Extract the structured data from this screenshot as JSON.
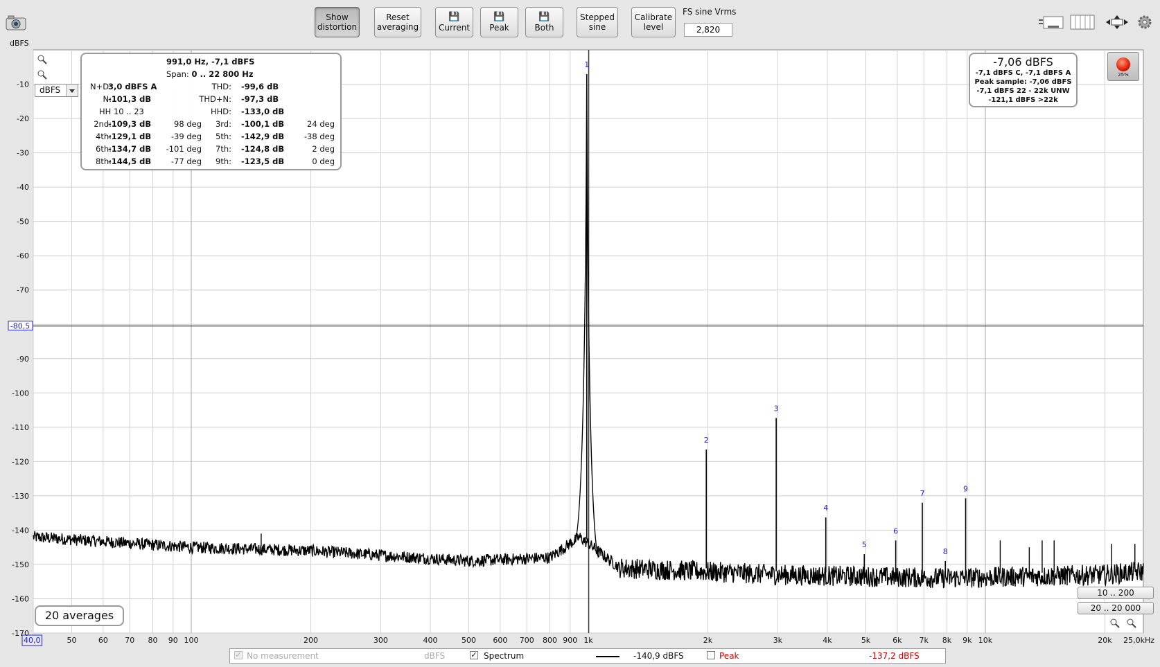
{
  "toolbar": {
    "show_distortion": "Show\ndistortion",
    "show_distortion_1": "Show",
    "show_distortion_2": "distortion",
    "reset_1": "Reset",
    "reset_2": "averaging",
    "current": "Current",
    "peak": "Peak",
    "both": "Both",
    "stepped_1": "Stepped",
    "stepped_2": "sine",
    "calibrate_1": "Calibrate",
    "calibrate_2": "level",
    "fs_label": "FS sine Vrms",
    "fs_value": "2,820"
  },
  "icons": [
    "camera-icon",
    "save-icon",
    "layout-icon",
    "grid-icon",
    "fit-arrows-icon",
    "gear-icon",
    "zoom-in-icon",
    "zoom-out-icon"
  ],
  "unit_label": "dBFS",
  "unit_select": "dBFS",
  "cursor_label": "-80,5",
  "cursor_value": -80.5,
  "info": {
    "title": "991,0 Hz, -7,1 dBFS",
    "span_label": "Span:",
    "span_value": "0 .. 22 800 Hz",
    "nd_label": "N+D:",
    "nd_value": "3,0 dBFS A",
    "n_label": "N:",
    "n_value": "-101,3 dB",
    "hh_label": "HH 10 .. 23",
    "thd_label": "THD:",
    "thd_value": "-99,6 dB",
    "thdn_label": "THD+N:",
    "thdn_value": "-97,3 dB",
    "hhd_label": "HHD:",
    "hhd_value": "-133,0 dB",
    "harmonics": [
      {
        "l": "2nd:",
        "v": "-109,3 dB",
        "p": "98 deg"
      },
      {
        "l": "3rd:",
        "v": "-100,1 dB",
        "p": "24 deg"
      },
      {
        "l": "4th:",
        "v": "-129,1 dB",
        "p": "-39 deg"
      },
      {
        "l": "5th:",
        "v": "-142,9 dB",
        "p": "-38 deg"
      },
      {
        "l": "6th:",
        "v": "-134,7 dB",
        "p": "-101 deg"
      },
      {
        "l": "7th:",
        "v": "-124,8 dB",
        "p": "2 deg"
      },
      {
        "l": "8th:",
        "v": "-144,5 dB",
        "p": "-77 deg"
      },
      {
        "l": "9th:",
        "v": "-123,5 dB",
        "p": "0 deg"
      }
    ]
  },
  "level": {
    "main": "-7,06 dBFS",
    "line1": "-7,1 dBFS C, -7,1 dBFS A",
    "line2": "Peak sample: -7,06 dBFS",
    "line3": "-7,1 dBFS 22 - 22k UNW",
    "line4": "-121,1 dBFS >22k"
  },
  "record": {
    "percent": "25%",
    "color": "#e21b00"
  },
  "averages": "20 averages",
  "ranges": {
    "r1": "10 .. 200",
    "r2": "20 .. 20 000"
  },
  "legend": {
    "no_measurement": "No measurement",
    "no_measurement_unit": "dBFS",
    "spectrum": "Spectrum",
    "spectrum_value": "-140,9 dBFS",
    "peak": "Peak",
    "peak_value": "-137,2 dBFS",
    "peak_color": "#cc0000"
  },
  "chart_data": {
    "type": "line",
    "xscale": "log",
    "xlim": [
      40,
      25000
    ],
    "ylim": [
      -170,
      0
    ],
    "ylabel": "dBFS",
    "grid": true,
    "y_ticks": [
      -10,
      -20,
      -30,
      -40,
      -50,
      -60,
      -70,
      -80,
      -90,
      -100,
      -110,
      -120,
      -130,
      -140,
      -150,
      -160,
      -170
    ],
    "x_ticks": [
      {
        "v": 40,
        "l": "40,0"
      },
      {
        "v": 50,
        "l": "50"
      },
      {
        "v": 60,
        "l": "60"
      },
      {
        "v": 70,
        "l": "70"
      },
      {
        "v": 80,
        "l": "80"
      },
      {
        "v": 90,
        "l": "90"
      },
      {
        "v": 100,
        "l": "100"
      },
      {
        "v": 200,
        "l": "200"
      },
      {
        "v": 300,
        "l": "300"
      },
      {
        "v": 400,
        "l": "400"
      },
      {
        "v": 500,
        "l": "500"
      },
      {
        "v": 600,
        "l": "600"
      },
      {
        "v": 700,
        "l": "700"
      },
      {
        "v": 800,
        "l": "800"
      },
      {
        "v": 900,
        "l": "900"
      },
      {
        "v": 1000,
        "l": "1k"
      },
      {
        "v": 2000,
        "l": "2k"
      },
      {
        "v": 3000,
        "l": "3k"
      },
      {
        "v": 4000,
        "l": "4k"
      },
      {
        "v": 5000,
        "l": "5k"
      },
      {
        "v": 6000,
        "l": "6k"
      },
      {
        "v": 7000,
        "l": "7k"
      },
      {
        "v": 8000,
        "l": "8k"
      },
      {
        "v": 9000,
        "l": "9k"
      },
      {
        "v": 10000,
        "l": "10k"
      },
      {
        "v": 20000,
        "l": "20k"
      },
      {
        "v": 25000,
        "l": "25,0kHz"
      }
    ],
    "noise_floor": [
      [
        40,
        -142
      ],
      [
        100,
        -145
      ],
      [
        200,
        -146
      ],
      [
        500,
        -149
      ],
      [
        800,
        -148
      ],
      [
        950,
        -142
      ],
      [
        1200,
        -151
      ],
      [
        3000,
        -153
      ],
      [
        8000,
        -154
      ],
      [
        20000,
        -153
      ],
      [
        25000,
        -152
      ]
    ],
    "peaks": [
      {
        "label": "1",
        "f": 991,
        "db": -7.1
      },
      {
        "label": "2",
        "f": 1982,
        "db": -116.5
      },
      {
        "label": "3",
        "f": 2973,
        "db": -107.3
      },
      {
        "label": "4",
        "f": 3964,
        "db": -136.3
      },
      {
        "label": "5",
        "f": 4955,
        "db": -147.0
      },
      {
        "label": "6",
        "f": 5946,
        "db": -143.0
      },
      {
        "label": "7",
        "f": 6937,
        "db": -132.0
      },
      {
        "label": "8",
        "f": 7928,
        "db": -149.0
      },
      {
        "label": "9",
        "f": 8919,
        "db": -130.7
      }
    ],
    "extra_spurs": [
      [
        150,
        -141
      ],
      [
        10900,
        -143
      ],
      [
        12900,
        -145
      ],
      [
        13900,
        -143
      ],
      [
        14900,
        -143
      ],
      [
        20800,
        -144
      ],
      [
        23800,
        -144
      ]
    ]
  }
}
